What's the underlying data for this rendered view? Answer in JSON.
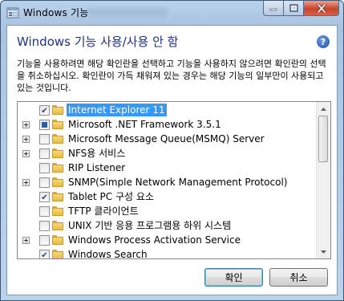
{
  "window": {
    "title": "Windows 기능",
    "icon": "windows-features-icon"
  },
  "header": {
    "heading": "Windows 기능 사용/사용 안 함",
    "help_icon_glyph": "?"
  },
  "description": "기능을 사용하려면 해당 확인란을 선택하고 기능을 사용하지 않으려면 확인란의 선택을 취소하십시오. 확인란이 가득 채워져 있는 경우는 해당 기능의 일부만이 사용되고 있는 것입니다.",
  "features": [
    {
      "label": "Internet Explorer 11",
      "state": "checked",
      "expandable": false,
      "selected": true
    },
    {
      "label": "Microsoft .NET Framework 3.5.1",
      "state": "partial",
      "expandable": true,
      "selected": false
    },
    {
      "label": "Microsoft Message Queue(MSMQ) Server",
      "state": "unchecked",
      "expandable": true,
      "selected": false
    },
    {
      "label": "NFS용 서비스",
      "state": "unchecked",
      "expandable": true,
      "selected": false
    },
    {
      "label": "RIP Listener",
      "state": "unchecked",
      "expandable": false,
      "selected": false
    },
    {
      "label": "SNMP(Simple Network Management Protocol)",
      "state": "unchecked",
      "expandable": true,
      "selected": false
    },
    {
      "label": "Tablet PC 구성 요소",
      "state": "checked",
      "expandable": false,
      "selected": false
    },
    {
      "label": "TFTP 클라이언트",
      "state": "unchecked",
      "expandable": false,
      "selected": false
    },
    {
      "label": "UNIX 기반 응용 프로그램용 하위 시스템",
      "state": "unchecked",
      "expandable": false,
      "selected": false
    },
    {
      "label": "Windows Process Activation Service",
      "state": "unchecked",
      "expandable": true,
      "selected": false
    },
    {
      "label": "Windows Search",
      "state": "checked",
      "expandable": false,
      "selected": false
    }
  ],
  "buttons": {
    "ok": "확인",
    "cancel": "취소"
  },
  "colors": {
    "heading": "#1e3287",
    "selection": "#3399ff",
    "close_button": "#c9442b"
  }
}
